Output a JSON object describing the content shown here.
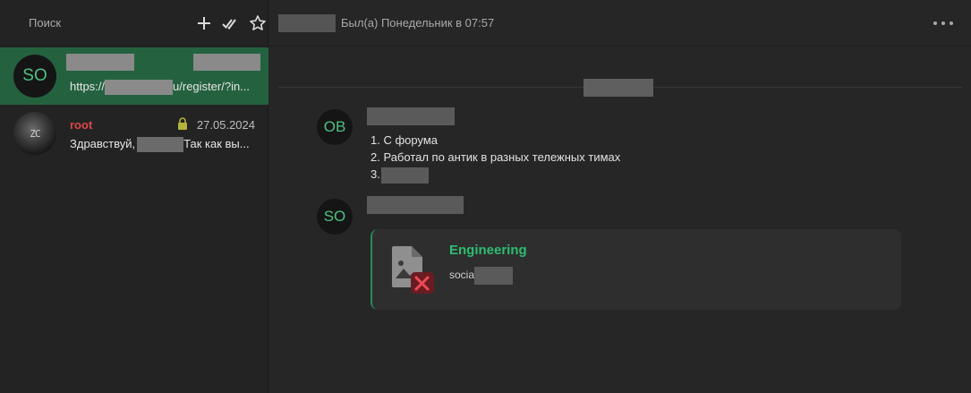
{
  "search": {
    "placeholder": "Поиск"
  },
  "header_icons": [
    "plus-icon",
    "double-check-icon",
    "star-icon"
  ],
  "chats": [
    {
      "avatar_text": "SO",
      "name": "",
      "date": "",
      "preview_prefix": "https://",
      "preview_suffix": "u/register/?in...",
      "active": true
    },
    {
      "avatar_text": "ZC",
      "name": "root",
      "date": "27.05.2024",
      "preview_prefix": "Здравствуй,",
      "preview_suffix": "Так как вы...",
      "locked": true
    }
  ],
  "conversation": {
    "status": "Был(а) Понедельник в 07:57",
    "messages": [
      {
        "avatar_text": "OB",
        "lines": [
          "1. С форума",
          "2. Работал по антик в разных тележных тимах",
          "3."
        ]
      },
      {
        "avatar_text": "SO",
        "card": {
          "title": "Engineering",
          "subtitle_prefix": "socia"
        }
      }
    ]
  },
  "colors": {
    "accent": "#2dbd70",
    "active_chat": "#24623f",
    "name_red": "#e04646"
  }
}
